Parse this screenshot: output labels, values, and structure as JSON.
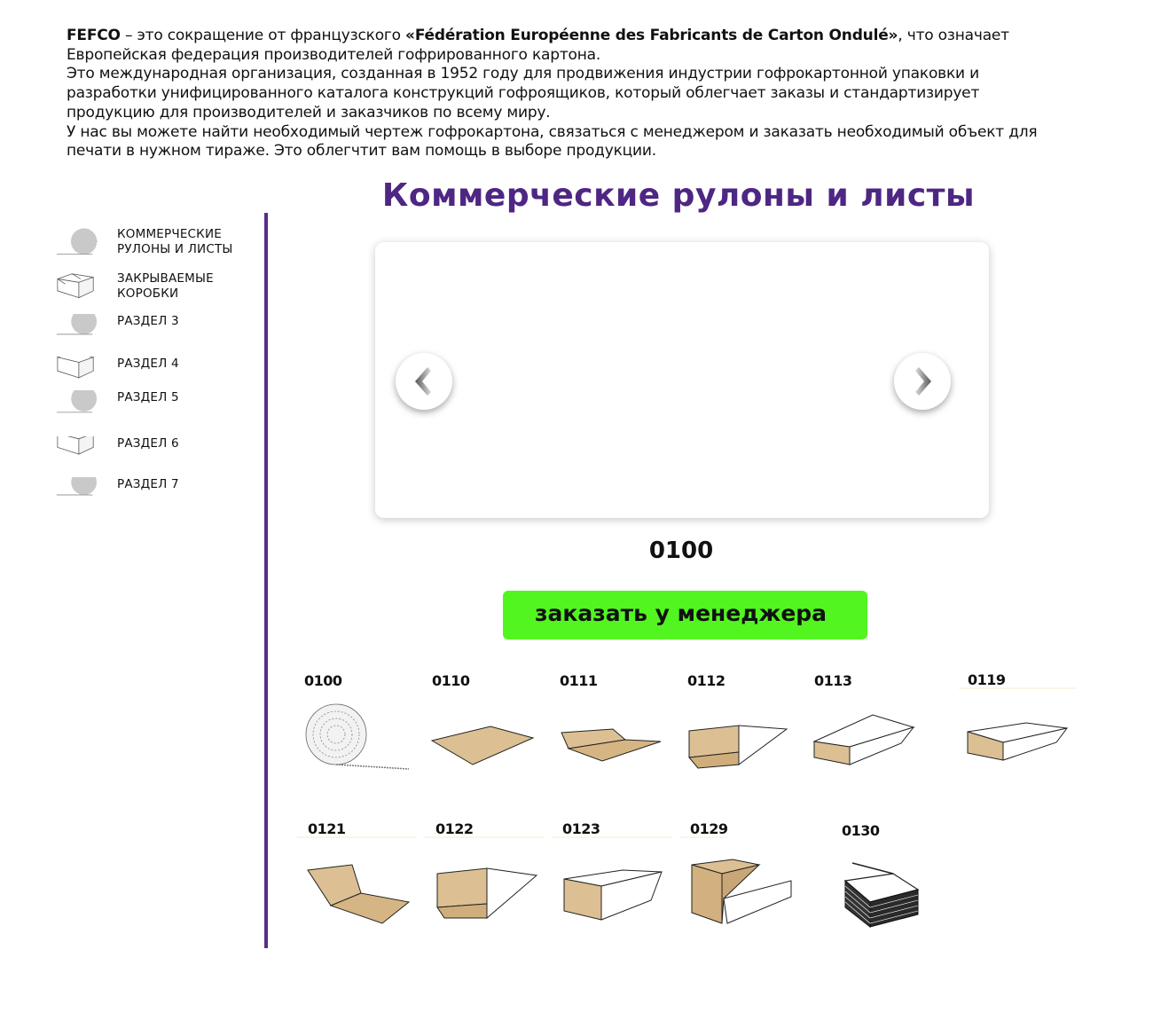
{
  "intro": {
    "p1_brand": "FEFCO",
    "p1_text1": " – это сокращение от французского ",
    "p1_fullname": "«Fédération Européenne des Fabricants de Carton Ondulé»",
    "p1_text2": ", что означает Европейская федерация производителей гофрированного картона.",
    "p2": "Это международная организация, созданная в 1952 году для продвижения индустрии гофрокартонной упаковки и разработки унифицированного каталога конструкций гофроящиков, который облегчает заказы и стандартизирует продукцию для производителей и заказчиков по всему миру.",
    "p3": "У нас вы можете найти необходимый чертеж гофрокартона, связаться с менеджером и заказать необходимый объект для печати в нужном тираже. Это облегчтит вам помощь в выборе продукции."
  },
  "sidebar": {
    "items": [
      {
        "label": "КОММЕРЧЕСКИЕ РУЛОНЫ И ЛИСТЫ",
        "icon": "roll-icon"
      },
      {
        "label": "ЗАКРЫВАЕМЫЕ КОРОБКИ",
        "icon": "box-icon"
      },
      {
        "label": "РАЗДЕЛ 3",
        "icon": "roll-icon"
      },
      {
        "label": "РАЗДЕЛ 4",
        "icon": "box-icon"
      },
      {
        "label": "РАЗДЕЛ 5",
        "icon": "roll-icon"
      },
      {
        "label": "РАЗДЕЛ 6",
        "icon": "box-icon"
      },
      {
        "label": "РАЗДЕЛ 7",
        "icon": "roll-icon"
      }
    ]
  },
  "main": {
    "title": "Коммерческие рулоны и листы",
    "selected_code": "0100",
    "order_button": "заказать у менеджера"
  },
  "catalog": {
    "items": [
      {
        "code": "0100",
        "shape": "roll"
      },
      {
        "code": "0110",
        "shape": "sheet"
      },
      {
        "code": "0111",
        "shape": "folded-sheet"
      },
      {
        "code": "0112",
        "shape": "tray-open"
      },
      {
        "code": "0113",
        "shape": "sleeve"
      },
      {
        "code": "0119",
        "shape": "sleeve-open"
      },
      {
        "code": "0121",
        "shape": "wrap-flat"
      },
      {
        "code": "0122",
        "shape": "wrap-side"
      },
      {
        "code": "0123",
        "shape": "wrap-box"
      },
      {
        "code": "0129",
        "shape": "wrap-tall"
      },
      {
        "code": "0130",
        "shape": "stack"
      }
    ]
  },
  "colors": {
    "accent": "#4e2683",
    "divider": "#5b2d8a",
    "button": "#52f51f",
    "cardboard": "#dcbf93"
  }
}
